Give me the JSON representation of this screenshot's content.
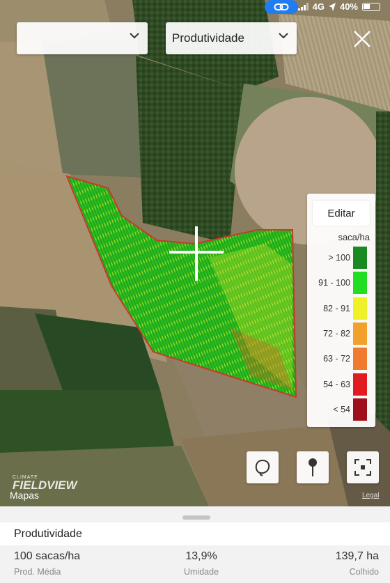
{
  "status_bar": {
    "network": "4G",
    "battery": "40%"
  },
  "header": {
    "field_select": {
      "value": ""
    },
    "layer_select": {
      "value": "Produtividade"
    }
  },
  "legend": {
    "edit_label": "Editar",
    "unit": "saca/ha",
    "ranges": [
      {
        "label": "> 100",
        "color": "#1a8a22"
      },
      {
        "label": "91 - 100",
        "color": "#22dd22"
      },
      {
        "label": "82 - 91",
        "color": "#eef028"
      },
      {
        "label": "72 - 82",
        "color": "#f2a02a"
      },
      {
        "label": "63 - 72",
        "color": "#f07a2e"
      },
      {
        "label": "54 - 63",
        "color": "#e01c22"
      },
      {
        "label": "< 54",
        "color": "#a0101c"
      }
    ]
  },
  "map": {
    "brand_small": "CLIMATE",
    "brand_big": "FIELDVIEW",
    "attribution": "Mapas",
    "legal": "Legal"
  },
  "panel": {
    "title": "Produtividade",
    "stats": [
      {
        "value": "100 sacas/ha",
        "label": "Prod. Média"
      },
      {
        "value": "13,9%",
        "label": "Umidade"
      },
      {
        "value": "139,7 ha",
        "label": "Colhido"
      }
    ]
  }
}
